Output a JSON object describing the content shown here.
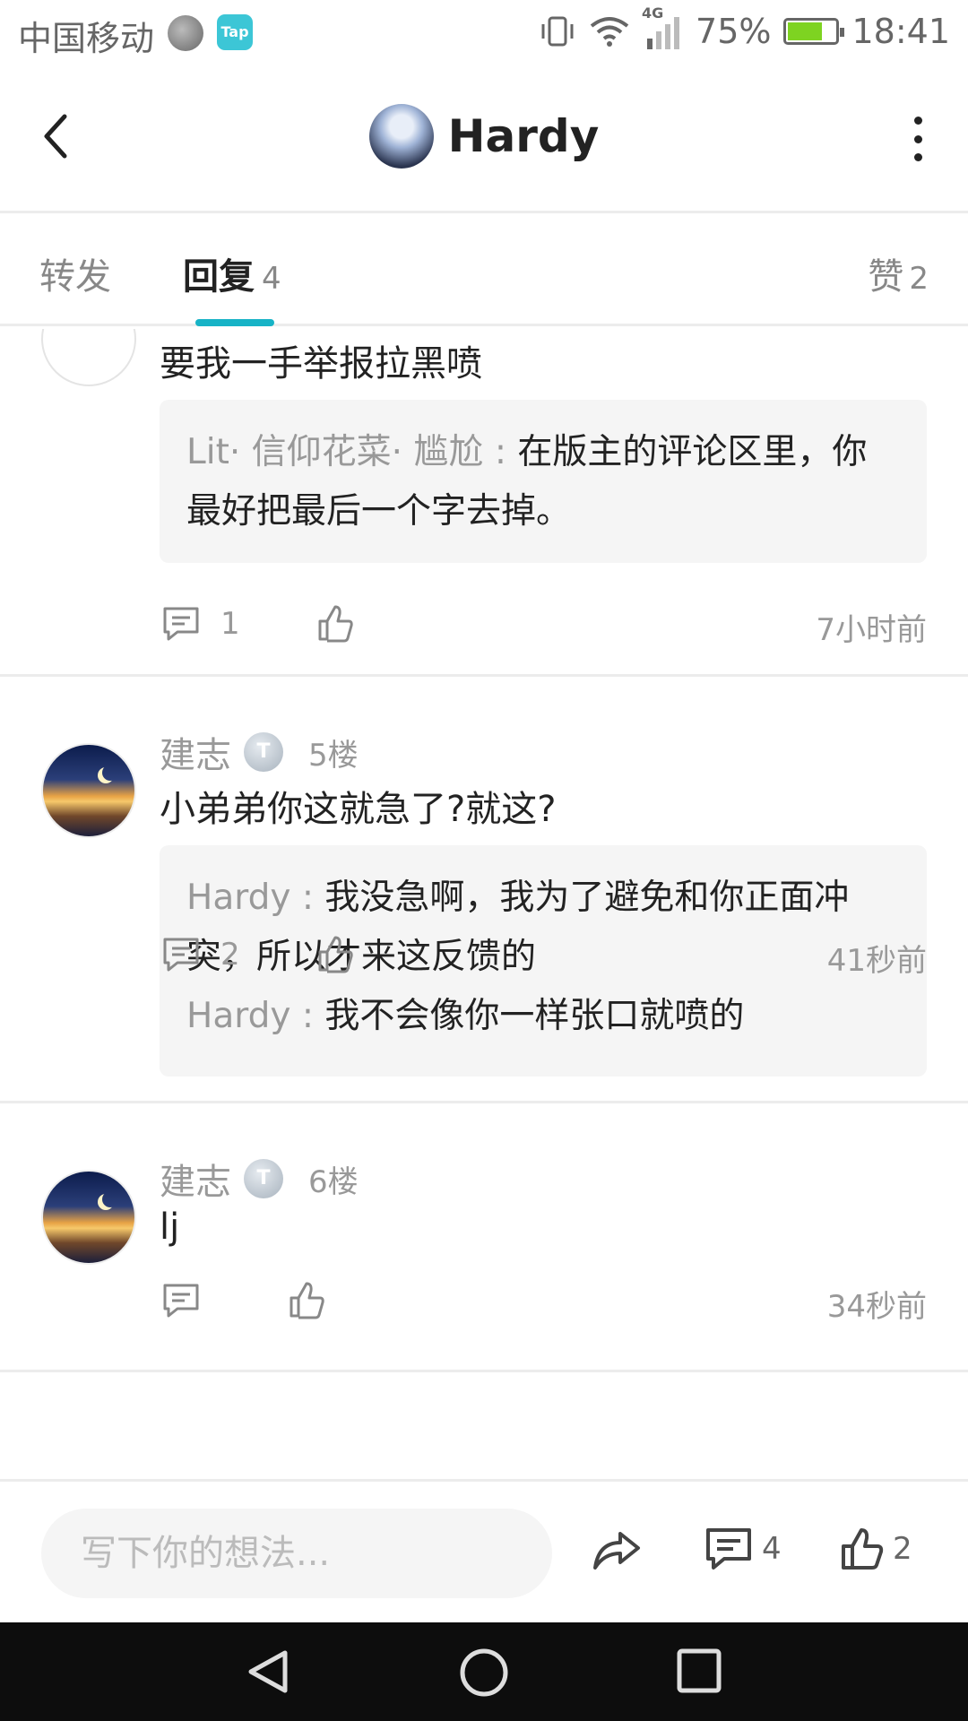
{
  "status_bar": {
    "carrier": "中国移动",
    "app_badge": "Tap",
    "network": "4G",
    "battery": "75%",
    "battery_level": 0.75,
    "time": "18:41"
  },
  "header": {
    "title": "Hardy"
  },
  "tabs": {
    "forward": "转发",
    "reply": "回复",
    "reply_count": "4",
    "like": "赞",
    "like_count": "2",
    "active": "reply"
  },
  "posts": [
    {
      "content": "要我一手举报拉黑喷",
      "quotes": [
        {
          "name": "Lit· 信仰花菜· 尴尬",
          "sep": " : ",
          "text": "在版主的评论区里，你最好把最后一个字去掉。"
        }
      ],
      "reply_count": "1",
      "time": "7小时前"
    },
    {
      "username": "建志",
      "level": "T",
      "floor": "5楼",
      "content": "小弟弟你这就急了?就这?",
      "quotes": [
        {
          "name": "Hardy",
          "sep": " : ",
          "text": "我没急啊，我为了避免和你正面冲突，所以才来这反馈的"
        },
        {
          "name": "Hardy",
          "sep": " : ",
          "text": "我不会像你一样张口就喷的"
        }
      ],
      "reply_count": "2",
      "time": "41秒前"
    },
    {
      "username": "建志",
      "level": "T",
      "floor": "6楼",
      "content": "lj",
      "time": "34秒前"
    }
  ],
  "bottom_bar": {
    "input_placeholder": "写下你的想法...",
    "comment_count": "4",
    "like_count": "2"
  },
  "colors": {
    "accent": "#17b3c6",
    "muted_text": "#999999",
    "quote_bg": "#f5f5f5"
  }
}
